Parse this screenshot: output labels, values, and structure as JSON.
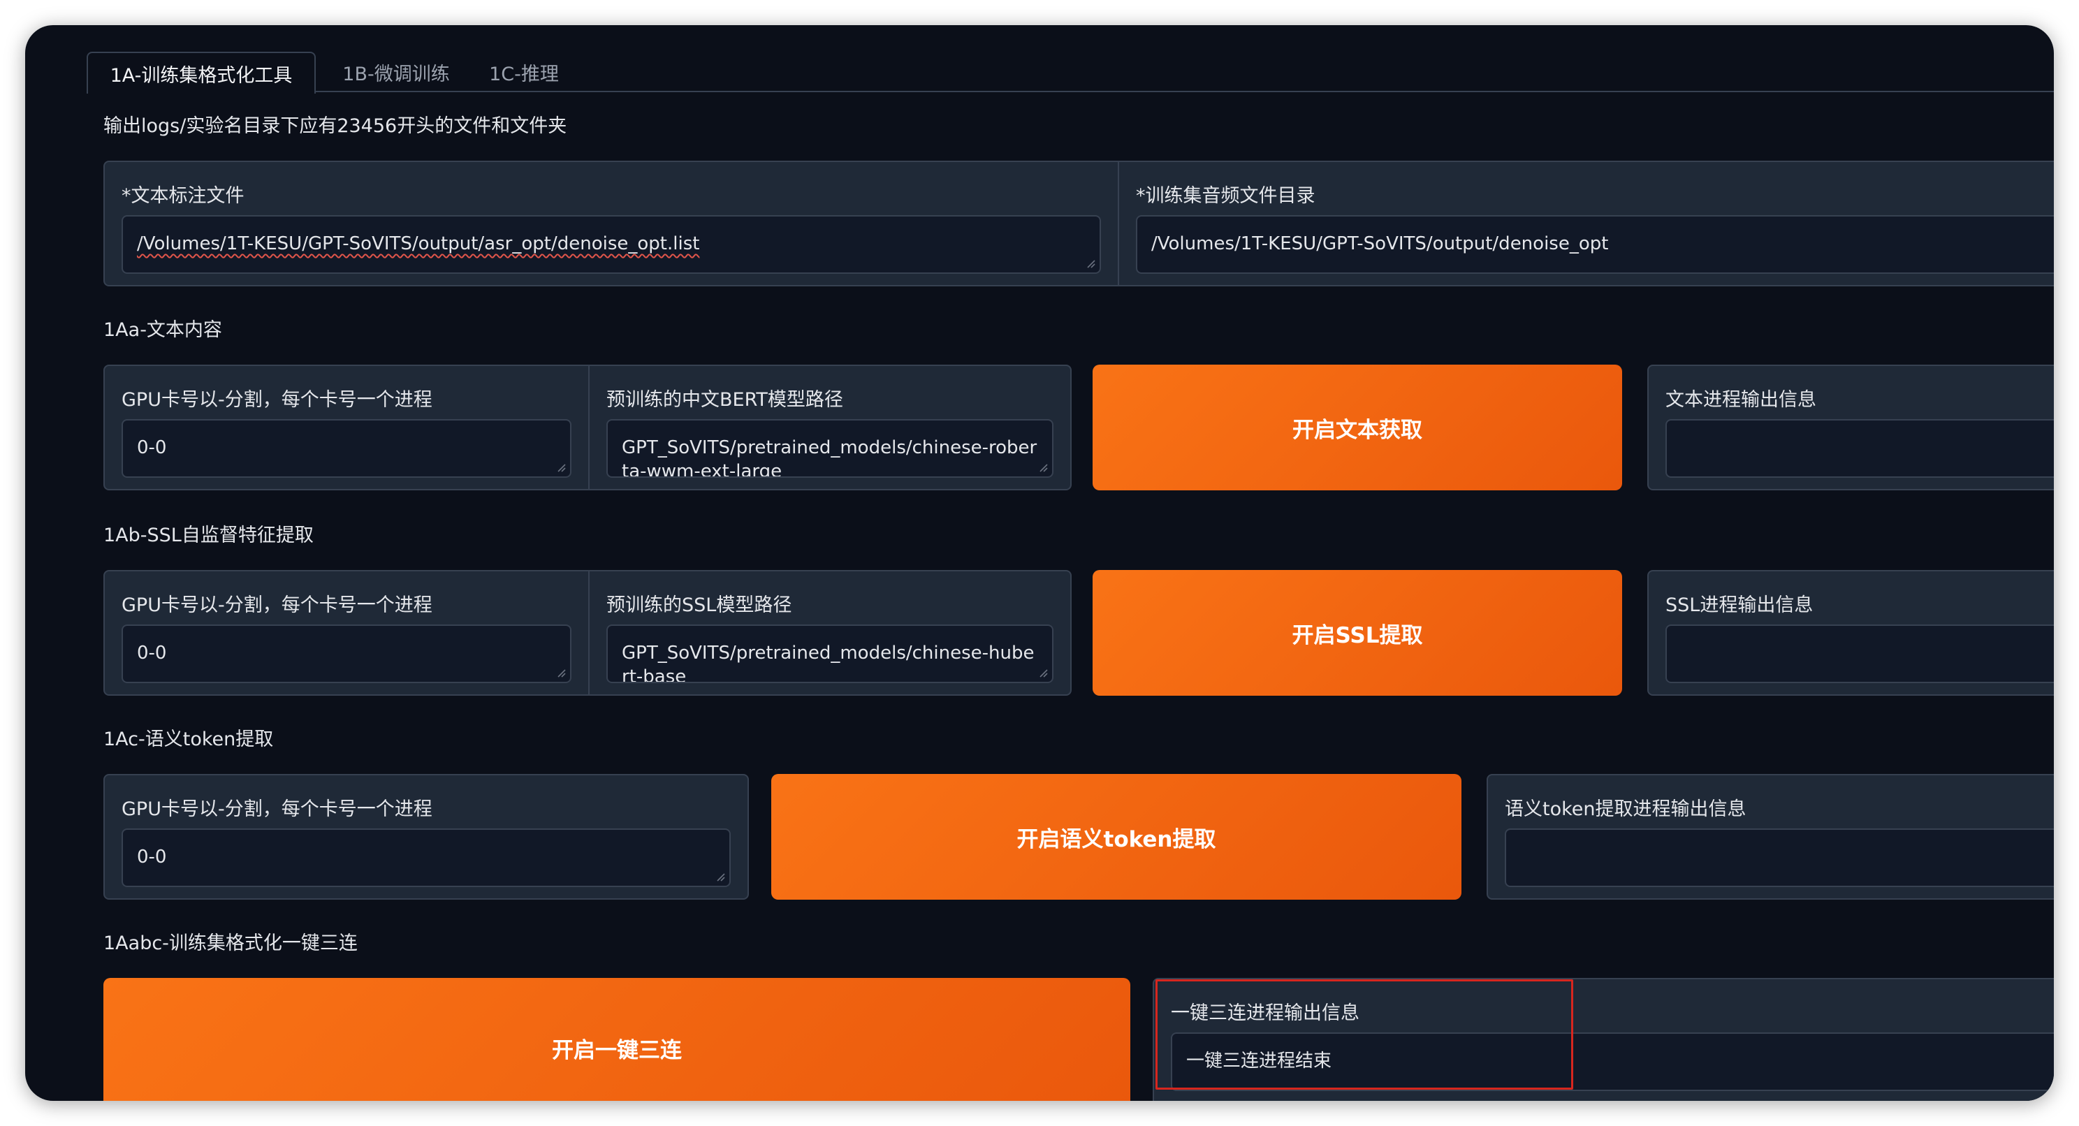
{
  "tabs": [
    {
      "label": "1A-训练集格式化工具"
    },
    {
      "label": "1B-微调训练"
    },
    {
      "label": "1C-推理"
    }
  ],
  "intro_text": "输出logs/实验名目录下应有23456开头的文件和文件夹",
  "inputs_row": {
    "text_label_file": {
      "label": "*文本标注文件",
      "value": "/Volumes/1T-KESU/GPT-SoVITS/output/asr_opt/denoise_opt.list"
    },
    "audio_dir": {
      "label": "*训练集音频文件目录",
      "value": "/Volumes/1T-KESU/GPT-SoVITS/output/denoise_opt"
    }
  },
  "section_1a": {
    "title": "1Aa-文本内容",
    "gpu_label": "GPU卡号以-分割，每个卡号一个进程",
    "gpu_value": "0-0",
    "bert_label": "预训练的中文BERT模型路径",
    "bert_value": "GPT_SoVITS/pretrained_models/chinese-roberta-wwm-ext-large",
    "button": "开启文本获取",
    "output_label": "文本进程输出信息",
    "output_value": ""
  },
  "section_1b": {
    "title": "1Ab-SSL自监督特征提取",
    "gpu_label": "GPU卡号以-分割，每个卡号一个进程",
    "gpu_value": "0-0",
    "ssl_label": "预训练的SSL模型路径",
    "ssl_value": "GPT_SoVITS/pretrained_models/chinese-hubert-base",
    "button": "开启SSL提取",
    "output_label": "SSL进程输出信息",
    "output_value": ""
  },
  "section_1c": {
    "title": "1Ac-语义token提取",
    "gpu_label": "GPU卡号以-分割，每个卡号一个进程",
    "gpu_value": "0-0",
    "button": "开启语义token提取",
    "output_label": "语义token提取进程输出信息",
    "output_value": ""
  },
  "section_1abc": {
    "title": "1Aabc-训练集格式化一键三连",
    "button": "开启一键三连",
    "output_label": "一键三连进程输出信息",
    "output_value": "一键三连进程结束"
  },
  "colors": {
    "background": "#0b0f19",
    "panel": "#1f2937",
    "border": "#374151",
    "accent": "#f97316",
    "highlight": "#d7261e"
  }
}
